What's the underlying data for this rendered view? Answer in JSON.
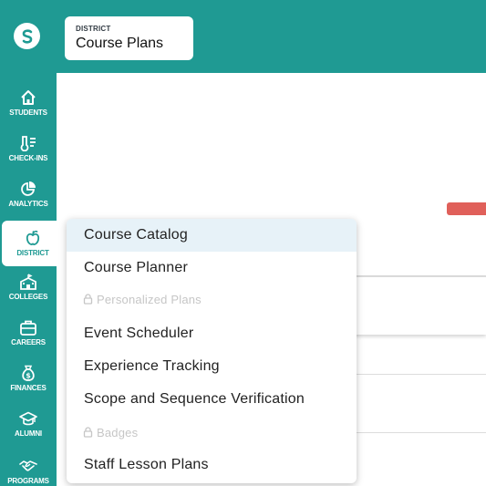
{
  "header": {
    "context_label": "DISTRICT",
    "context_title": "Course Plans",
    "logo_icon": "brand-s-icon"
  },
  "sidebar": {
    "items": [
      {
        "label": "STUDENTS",
        "icon": "home-icon"
      },
      {
        "label": "CHECK-INS",
        "icon": "thermometer-icon"
      },
      {
        "label": "ANALYTICS",
        "icon": "pie-chart-icon"
      },
      {
        "label": "DISTRICT",
        "icon": "apple-icon",
        "active": true
      },
      {
        "label": "COLLEGES",
        "icon": "school-icon"
      },
      {
        "label": "CAREERS",
        "icon": "briefcase-icon"
      },
      {
        "label": "FINANCES",
        "icon": "money-bag-icon"
      },
      {
        "label": "ALUMNI",
        "icon": "graduation-cap-icon"
      },
      {
        "label": "PROGRAMS",
        "icon": "handshake-icon"
      }
    ]
  },
  "menu": {
    "items": [
      {
        "label": "Course Catalog",
        "highlighted": true
      },
      {
        "label": "Course Planner"
      },
      {
        "label": "Personalized Plans",
        "disabled": true
      },
      {
        "label": "Event Scheduler"
      },
      {
        "label": "Experience Tracking"
      },
      {
        "label": "Scope and Sequence Verification"
      },
      {
        "label": "Badges",
        "disabled": true
      },
      {
        "label": "Staff Lesson Plans"
      }
    ]
  },
  "colors": {
    "brand_teal": "#1f9a93",
    "highlight": "#e7f2f8",
    "alert_red": "#e0605a",
    "disabled_text": "#c6c6c6"
  }
}
